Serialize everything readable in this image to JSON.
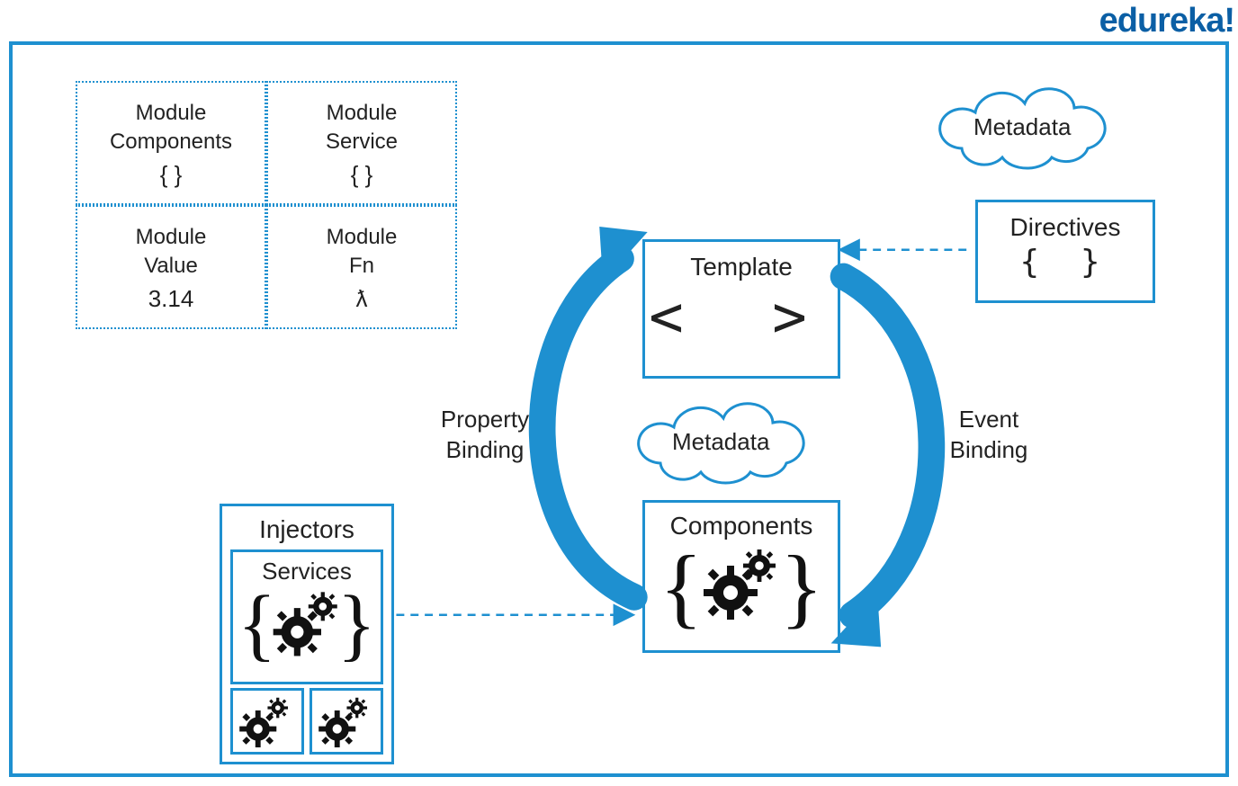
{
  "logo": "edureka!",
  "modules": {
    "topLeft": {
      "title": "Module\nComponents",
      "symbol": "{ }"
    },
    "topRight": {
      "title": "Module\nService",
      "symbol": "{ }"
    },
    "botLeft": {
      "title": "Module\nValue",
      "symbol": "3.14"
    },
    "botRight": {
      "title": "Module\nFn",
      "symbol": "ƛ"
    }
  },
  "template": {
    "label": "Template",
    "symbol": "<  >"
  },
  "components": {
    "label": "Components"
  },
  "directives": {
    "label": "Directives",
    "symbol": "{  }"
  },
  "injectors": {
    "label": "Injectors"
  },
  "services": {
    "label": "Services"
  },
  "metadata_top": "Metadata",
  "metadata_center": "Metadata",
  "propertyBinding": "Property\nBinding",
  "eventBinding": "Event\nBinding"
}
